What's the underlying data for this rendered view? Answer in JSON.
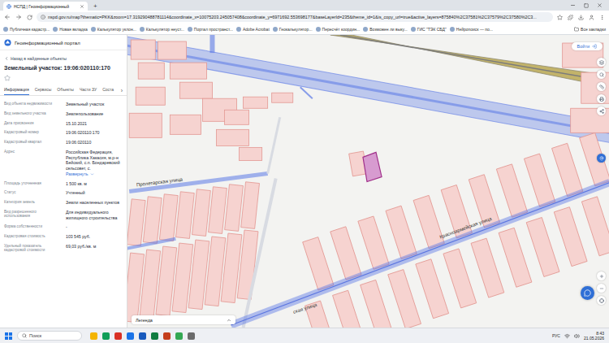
{
  "browser": {
    "tab_title": "НСПД | Геоинформационный",
    "new_tab": "+",
    "url": "nspd.gov.ru/map?thematic=PKK&zoom=17.319290488781114&coordinate_x=10075203.245057408&coordinate_y=6971692.553698177&baseLayerId=235&theme_id=1&is_copy_url=true&active_layers=875840%2C37581%2C37579%2C37580%2C3...",
    "bookmarks": [
      "Публичная кадастр...",
      "Новая вкладка",
      "Калькулятор уклон...",
      "Калькулятор неуст...",
      "Портал пространст...",
      "Adobe Acrobat",
      "Геокалькулятор...",
      "Пересчёт координ...",
      "Возможен ли выку...",
      "ГИС \"ТЭК СБД\"",
      "Нейропоиск — по..."
    ],
    "all_bookmarks": "Все закладки"
  },
  "portal": {
    "title": "Геоинформационный портал",
    "back": "Назад в найденные объекты",
    "object_title": "Земельный участок: 19:06:020110:170",
    "tabs": [
      {
        "label": "Информация",
        "selected": true
      },
      {
        "label": "Сервисы",
        "selected": false
      },
      {
        "label": "Объекты",
        "selected": false
      },
      {
        "label": "Части ЗУ",
        "selected": false
      },
      {
        "label": "Соста",
        "selected": false
      }
    ],
    "tabs_more": "›",
    "address_more": "Развернуть",
    "fields": [
      {
        "label": "Вид объекта недвижимости",
        "value": "Земельный участок",
        "kind": "text"
      },
      {
        "label": "Вид земельного участка",
        "value": "Землепользование",
        "kind": "text"
      },
      {
        "label": "Дата присвоения",
        "value": "15.10.2021",
        "kind": "text"
      },
      {
        "label": "Кадастровый номер",
        "value": "19:06:020110:170",
        "kind": "text"
      },
      {
        "label": "Кадастровый квартал",
        "value": "19:06:020110",
        "kind": "text"
      },
      {
        "label": "Адрес",
        "value": "Российская Федерация, Республика Хакасия, м.р-н Бейский, с.п. Бондаревский сельсовет, с.",
        "kind": "address"
      },
      {
        "label": "Площадь уточненная",
        "value": "1 500 кв. м",
        "kind": "text"
      },
      {
        "label": "Статус",
        "value": "Учтенный",
        "kind": "text"
      },
      {
        "label": "Категория земель",
        "value": "Земли населенных пунктов",
        "kind": "text"
      },
      {
        "label": "Вид разрешенного использования",
        "value": "Для индивидуального жилищного строительства",
        "kind": "text"
      },
      {
        "label": "Форма собственности",
        "value": "-",
        "kind": "text"
      },
      {
        "label": "Кадастровая стоимость",
        "value": "103 545 руб.",
        "kind": "text"
      },
      {
        "label": "Удельный показатель кадастровой стоимости",
        "value": "69,03 руб./кв. м",
        "kind": "text"
      }
    ]
  },
  "map": {
    "login": "Войти",
    "legend": "Легенда",
    "streets": [
      "Пролетарская улица",
      "Красноармейская улица",
      "ская улица"
    ]
  },
  "taskbar": {
    "search": "Поиск",
    "lang": "РУС",
    "time": "8:43",
    "date": "21.05.2026"
  }
}
